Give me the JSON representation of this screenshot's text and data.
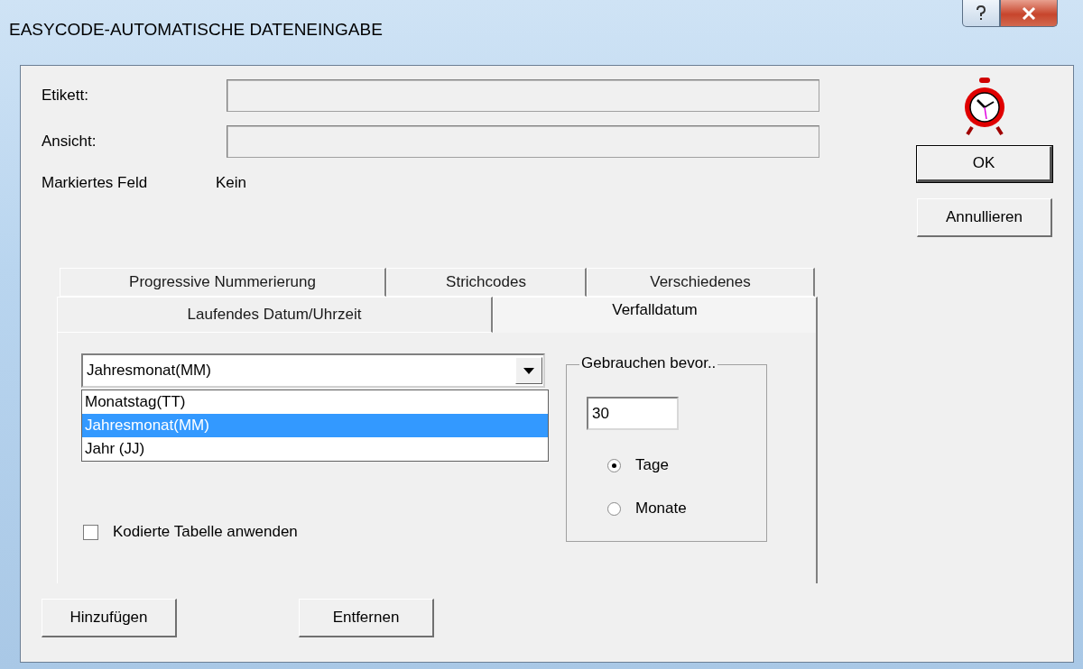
{
  "window": {
    "title": "EASYCODE-AUTOMATISCHE DATENEINGABE"
  },
  "fields": [
    {
      "label": "Etikett:"
    },
    {
      "label": "Ansicht:"
    }
  ],
  "marked_field": {
    "label": "Markiertes Feld",
    "value": "Kein"
  },
  "tab_rows": [
    {
      "tabs": [
        {
          "label": "Progressive Nummerierung",
          "selected": false
        },
        {
          "label": "Strichcodes",
          "selected": false
        },
        {
          "label": "Verschiedenes",
          "selected": false
        }
      ]
    },
    {
      "tabs": [
        {
          "label": "Laufendes Datum/Uhrzeit",
          "selected": false
        },
        {
          "label": "Verfalldatum",
          "selected": true
        }
      ]
    }
  ],
  "combo": {
    "value": "Jahresmonat(MM)",
    "expanded": true,
    "options": [
      {
        "label": "Monatstag(TT)",
        "selected": false
      },
      {
        "label": "Jahresmonat(MM)",
        "selected": true
      },
      {
        "label": "Jahr (JJ)",
        "selected": false
      }
    ]
  },
  "group": {
    "title": "Gebrauchen bevor..",
    "value": "30",
    "radios": [
      {
        "label": "Tage",
        "selected": true
      },
      {
        "label": "Monate",
        "selected": false
      }
    ]
  },
  "checkbox": {
    "label": "Kodierte Tabelle anwenden",
    "checked": false
  },
  "side_buttons": [
    {
      "label": "OK",
      "default": true
    },
    {
      "label": "Annullieren",
      "default": false
    }
  ],
  "bottom_buttons": [
    {
      "label": "Hinzufügen"
    },
    {
      "label": "Entfernen"
    }
  ]
}
